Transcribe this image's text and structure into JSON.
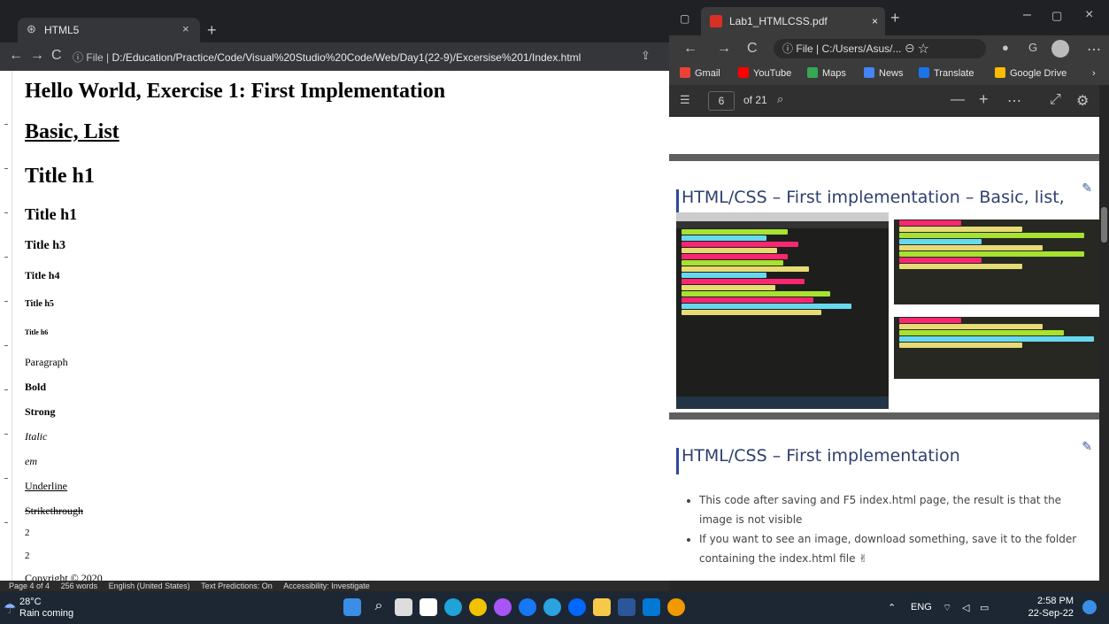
{
  "left_window": {
    "tab_title": "HTML5",
    "new_tab": "+",
    "file_label": "File",
    "url": "D:/Education/Practice/Code/Visual%20Studio%20Code/Web/Day1(22-9)/Excersise%201/Index.html",
    "content": {
      "heading_main": "Hello World, Exercise 1: First Implementation",
      "heading_basic": "Basic, List",
      "h1a": "Title h1",
      "h1b": "Title h1",
      "h3": "Title h3",
      "h4": "Title h4",
      "h5": "Title h5",
      "h6": "Title h6",
      "paragraph": "Paragraph",
      "bold": "Bold",
      "strong": "Strong",
      "italic": "Italic",
      "em": "em",
      "underline": "Underline",
      "strike": "Strikethrough",
      "sub": "2",
      "sup": "2",
      "copyright": "Copyright © 2020"
    },
    "statusbar": {
      "page": "Page 4 of 4",
      "words": "256 words",
      "language": "English (United States)",
      "predictions": "Text Predictions: On",
      "accessibility": "Accessibility: Investigate"
    }
  },
  "right_window": {
    "tab_title": "Lab1_HTMLCSS.pdf",
    "address": "C:/Users/Asus/...",
    "file_label": "File",
    "bookmarks": [
      "Gmail",
      "YouTube",
      "Maps",
      "News",
      "Translate",
      "Google Drive"
    ],
    "pdf_toolbar": {
      "page_value": "6",
      "page_total": "of 21"
    },
    "slides": [
      {
        "title": "HTML/CSS – First implementation – Basic, list,"
      },
      {
        "title": "HTML/CSS – First implementation",
        "bullets": [
          "This code after saving and F5 index.html page, the result is that the image is not visible",
          "If you want to see an image, download something, save it to the folder containing the index.html file ✌"
        ]
      }
    ]
  },
  "taskbar": {
    "temperature": "28°C",
    "weather": "Rain coming",
    "lang": "ENG",
    "time": "2:58 PM",
    "date": "22-Sep-22"
  },
  "colors": {
    "accent": "#2f3f6e",
    "taskbar": "#1c2733"
  }
}
